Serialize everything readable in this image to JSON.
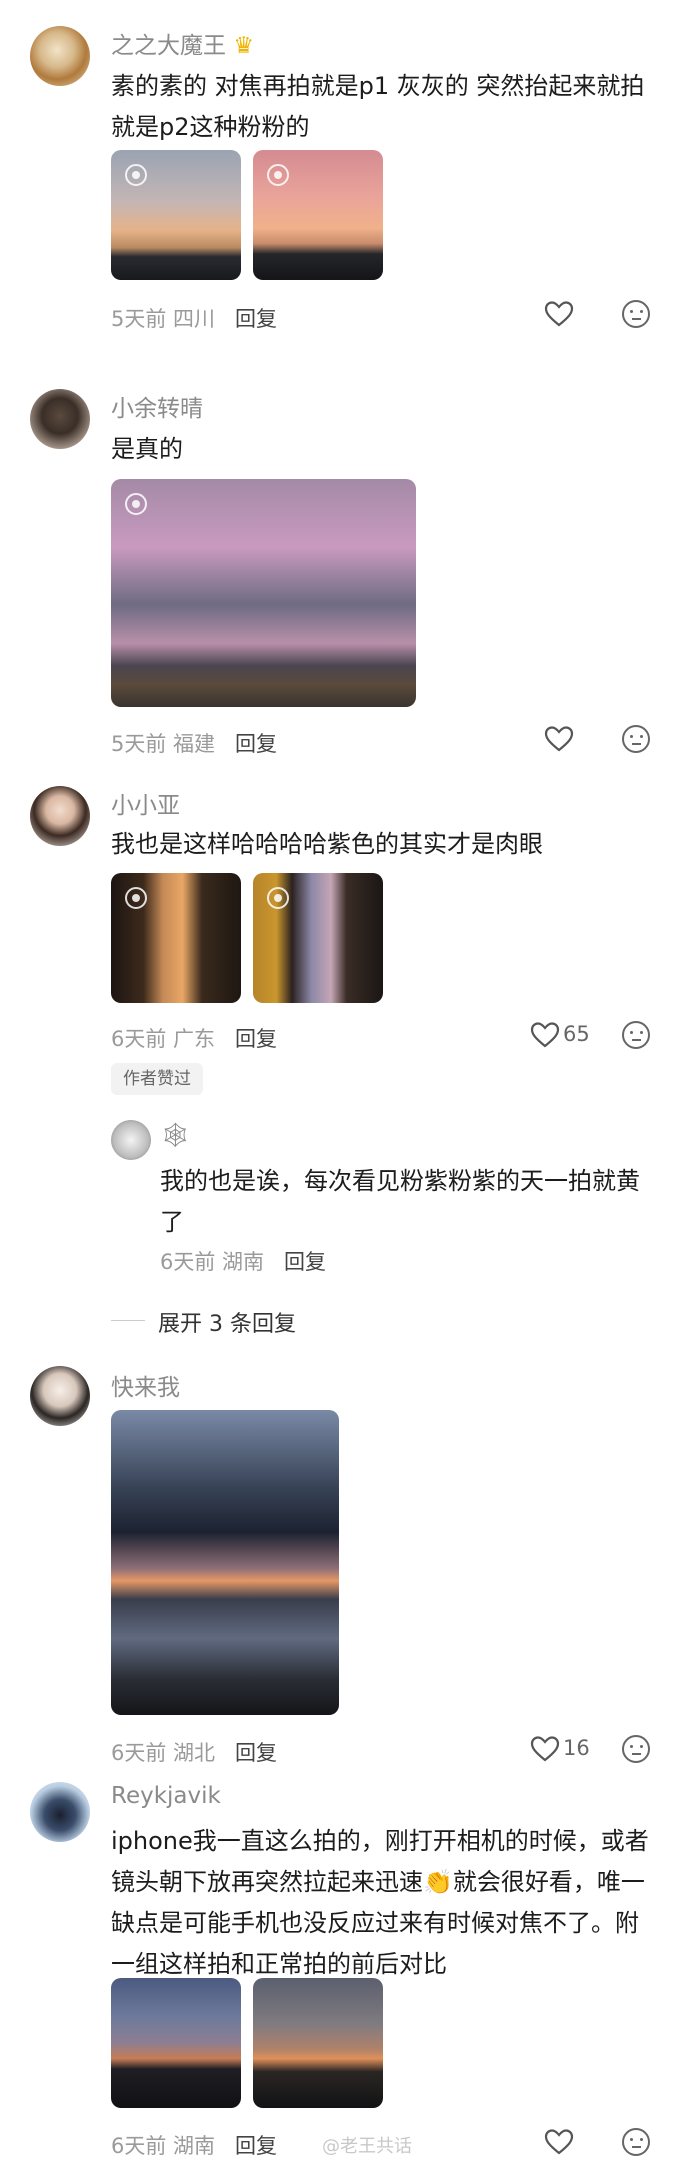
{
  "comments": [
    {
      "name": "之之大魔王",
      "text": "素的素的 对焦再拍就是p1 灰灰的 突然抬起来就拍就是p2这种粉粉的",
      "meta": "5天前 四川",
      "reply": "回复",
      "likes": ""
    },
    {
      "name": "小余转晴",
      "text": "是真的",
      "meta": "5天前 福建",
      "reply": "回复",
      "likes": ""
    },
    {
      "name": "小小亚",
      "text": "我也是这样哈哈哈哈紫色的其实才是肉眼",
      "meta": "6天前 广东",
      "reply": "回复",
      "likes": "65",
      "badge": "作者赞过"
    },
    {
      "name": "快来我",
      "text": "",
      "meta": "6天前 湖北",
      "reply": "回复",
      "likes": "16"
    },
    {
      "name": "Reykjavik",
      "text": "iphone我一直这么拍的，刚打开相机的时候，或者镜头朝下放再突然拉起来迅速👏就会很好看，唯一缺点是可能手机也没反应过来有时候对焦不了。附一组这样拍和正常拍的前后对比",
      "meta": "6天前 湖南",
      "reply": "回复",
      "likes": ""
    }
  ],
  "subreply": {
    "name": "🕸",
    "text": "我的也是诶，每次看见粉紫粉紫的天一拍就黄了",
    "meta": "6天前 湖南",
    "reply": "回复"
  },
  "expand_label": "展开 3 条回复",
  "watermark": "@老王共话",
  "colors": {
    "meta": "#9a9a9a",
    "name": "#8a8a8a",
    "text": "#1c1c1c"
  },
  "icons": [
    "heart-icon",
    "emoji-icon",
    "lens-icon",
    "crown-icon"
  ]
}
